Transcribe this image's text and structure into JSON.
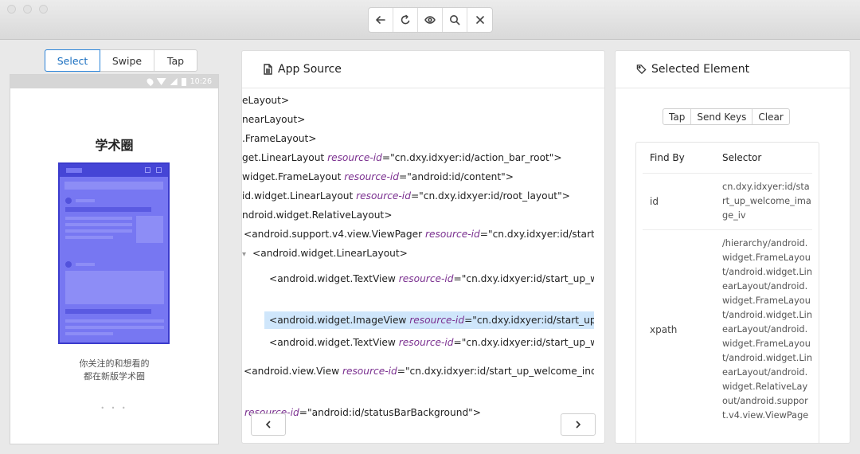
{
  "toolbar": {
    "buttons": [
      "back-icon",
      "refresh-icon",
      "eye-icon",
      "search-icon",
      "close-icon"
    ]
  },
  "modes": {
    "select": "Select",
    "swipe": "Swipe",
    "tap": "Tap"
  },
  "device": {
    "time": "10:26",
    "app_title": "学术圈",
    "caption_line1": "你关注的和想看的",
    "caption_line2": "都在新版学术圈",
    "page_dots": "• • •"
  },
  "source": {
    "title": "App Source",
    "nodes": [
      {
        "text": "eLayout>",
        "attr": "",
        "val": ""
      },
      {
        "text": "nearLayout>",
        "attr": "",
        "val": ""
      },
      {
        "text": ".FrameLayout>",
        "attr": "",
        "val": ""
      },
      {
        "text": "get.LinearLayout ",
        "attr": "resource-id",
        "val": "=\"cn.dxy.idxyer:id/action_bar_root\">"
      },
      {
        "text": "widget.FrameLayout ",
        "attr": "resource-id",
        "val": "=\"android:id/content\">"
      },
      {
        "text": "id.widget.LinearLayout ",
        "attr": "resource-id",
        "val": "=\"cn.dxy.idxyer:id/root_layout\">"
      },
      {
        "text": "ndroid.widget.RelativeLayout>",
        "attr": "",
        "val": ""
      },
      {
        "text": "<android.support.v4.view.ViewPager ",
        "attr": "resource-id",
        "val": "=\"cn.dxy.idxyer:id/start_up_wel"
      },
      {
        "text": "<android.widget.LinearLayout>",
        "attr": "",
        "val": ""
      },
      {
        "text": "<android.widget.TextView ",
        "attr": "resource-id",
        "val": "=\"cn.dxy.idxyer:id/start_up_welco"
      },
      {
        "text": "<android.widget.ImageView ",
        "attr": "resource-id",
        "val": "=\"cn.dxy.idxyer:id/start_up_welc"
      },
      {
        "text": "<android.widget.TextView ",
        "attr": "resource-id",
        "val": "=\"cn.dxy.idxyer:id/start_up_welco"
      },
      {
        "text": "<android.view.View ",
        "attr": "resource-id",
        "val": "=\"cn.dxy.idxyer:id/start_up_welcome_indicator"
      },
      {
        "text": "",
        "attr": "resource-id",
        "val": "=\"android:id/statusBarBackground\">"
      }
    ],
    "toggle_glyph": "▾"
  },
  "selected": {
    "title": "Selected Element",
    "actions": {
      "tap": "Tap",
      "send_keys": "Send Keys",
      "clear": "Clear"
    },
    "table": {
      "header_find_by": "Find By",
      "header_selector": "Selector",
      "rows": [
        {
          "key": "id",
          "value": "cn.dxy.idxyer:id/start_up_welcome_image_iv"
        },
        {
          "key": "xpath",
          "value": "/hierarchy/android.widget.FrameLayout/android.widget.LinearLayout/android.widget.FrameLayout/android.widget.LinearLayout/android.widget.FrameLayout/android.widget.LinearLayout/android.widget.RelativeLayout/android.support.v4.view.ViewPage"
        }
      ]
    }
  }
}
